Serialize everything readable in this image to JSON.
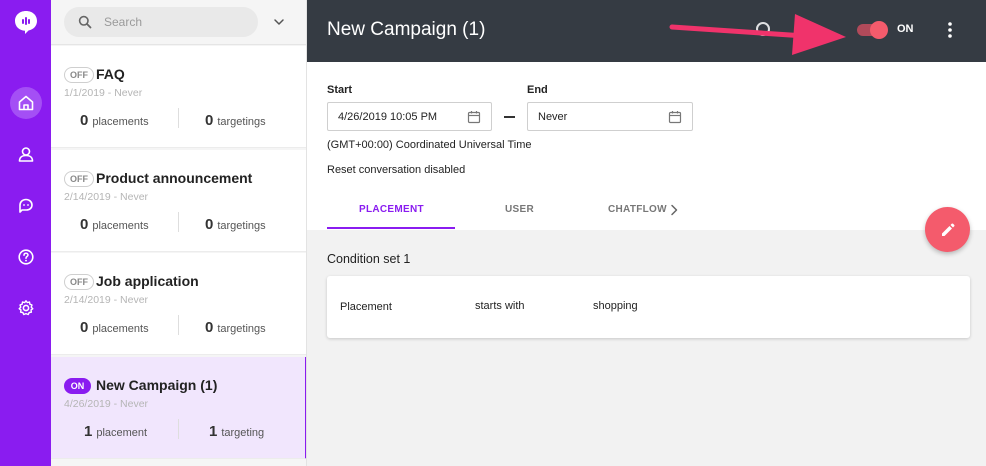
{
  "colors": {
    "accent": "#8a1cf0",
    "topbar": "#353b43",
    "fab": "#f45b6c",
    "arrow": "#f0336b"
  },
  "rail": {
    "logo_icon": "speech-bubble-logo-icon",
    "items": [
      {
        "icon": "home-icon",
        "active": true
      },
      {
        "icon": "user-icon",
        "active": false
      },
      {
        "icon": "chat-icon",
        "active": false
      },
      {
        "icon": "help-icon",
        "active": false
      },
      {
        "icon": "gear-icon",
        "active": false
      }
    ]
  },
  "list": {
    "search_placeholder": "Search",
    "campaigns": [
      {
        "status": "OFF",
        "title": "FAQ",
        "date": "1/1/2019 - Never",
        "placements_num": "0",
        "placements_label": "placements",
        "targetings_num": "0",
        "targetings_label": "targetings"
      },
      {
        "status": "OFF",
        "title": "Product announcement",
        "date": "2/14/2019 - Never",
        "placements_num": "0",
        "placements_label": "placements",
        "targetings_num": "0",
        "targetings_label": "targetings"
      },
      {
        "status": "OFF",
        "title": "Job application",
        "date": "2/14/2019 - Never",
        "placements_num": "0",
        "placements_label": "placements",
        "targetings_num": "0",
        "targetings_label": "targetings"
      },
      {
        "status": "ON",
        "title": "New Campaign (1)",
        "date": "4/26/2019 - Never",
        "placements_num": "1",
        "placements_label": "placement",
        "targetings_num": "1",
        "targetings_label": "targeting"
      }
    ]
  },
  "header": {
    "title": "New Campaign (1)",
    "toggle_label": "ON",
    "toggle_on": true
  },
  "schedule": {
    "start_label": "Start",
    "start_value": "4/26/2019 10:05 PM",
    "end_label": "End",
    "end_value": "Never",
    "timezone": "(GMT+00:00) Coordinated Universal Time",
    "reset": "Reset conversation disabled"
  },
  "tabs": [
    {
      "label": "PLACEMENT",
      "active": true
    },
    {
      "label": "USER",
      "active": false
    },
    {
      "label": "CHATFLOW",
      "active": false
    }
  ],
  "conditions": {
    "set_title": "Condition set 1",
    "rows": [
      {
        "field": "Placement",
        "operator": "starts with",
        "value": "shopping"
      }
    ]
  }
}
